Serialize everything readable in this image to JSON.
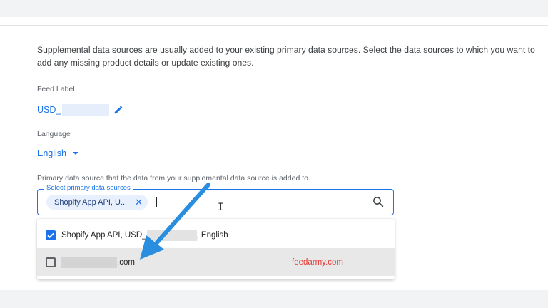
{
  "description": "Supplemental data sources are usually added to your existing primary data sources. Select the data sources to which you want to add any missing product details or update existing ones.",
  "feed_label": {
    "label": "Feed Label",
    "value_prefix": "USD_"
  },
  "language": {
    "label": "Language",
    "value": "English"
  },
  "primary_source": {
    "helper_text": "Primary data source that the data from your supplemental data source is added to.",
    "legend": "Select primary data sources",
    "chip_label": "Shopify App API, U...",
    "chip_close": "✕"
  },
  "dropdown": {
    "options": [
      {
        "prefix": "Shopify App API, USD_",
        "suffix": ", English",
        "checked": true
      },
      {
        "prefix": "",
        "suffix": ".com",
        "checked": false
      }
    ]
  },
  "watermark": "feedarmy.com",
  "colors": {
    "accent": "#1a73e8",
    "annotation_arrow": "#2a8ee0",
    "watermark": "#e53935"
  },
  "icons": [
    "edit-pencil-icon",
    "dropdown-caret-icon",
    "chip-close-icon",
    "search-icon",
    "checkbox-checked-icon",
    "checkbox-unchecked-icon",
    "text-cursor-icon",
    "annotation-arrow"
  ]
}
